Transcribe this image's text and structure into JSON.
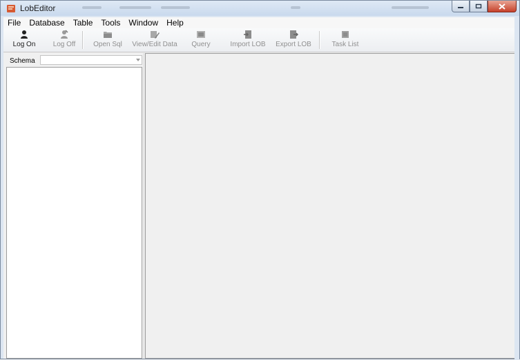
{
  "window": {
    "title": "LobEditor",
    "icons": {
      "app": "lob-editor-app-icon",
      "minimize": "minimize-icon",
      "maximize": "maximize-icon",
      "close": "close-icon"
    }
  },
  "menu": {
    "items": [
      "File",
      "Database",
      "Table",
      "Tools",
      "Window",
      "Help"
    ]
  },
  "toolbar": {
    "buttons": [
      {
        "label": "Log On",
        "icon": "log-on-icon",
        "enabled": true
      },
      {
        "label": "Log Off",
        "icon": "log-off-icon",
        "enabled": false
      },
      {
        "label": "Open Sql",
        "icon": "open-sql-icon",
        "enabled": false
      },
      {
        "label": "View/Edit Data",
        "icon": "view-edit-data-icon",
        "enabled": false
      },
      {
        "label": "Query",
        "icon": "query-icon",
        "enabled": false
      },
      {
        "label": "Import LOB",
        "icon": "import-lob-icon",
        "enabled": false
      },
      {
        "label": "Export LOB",
        "icon": "export-lob-icon",
        "enabled": false
      },
      {
        "label": "Task List",
        "icon": "task-list-icon",
        "enabled": false
      }
    ]
  },
  "left_pane": {
    "schema_label": "Schema",
    "schema_value": ""
  },
  "colors": {
    "titlebar": "#c9d9ed",
    "close_button": "#c7412a",
    "disabled_text": "#8f8f8f",
    "background": "#f0f0f0"
  }
}
